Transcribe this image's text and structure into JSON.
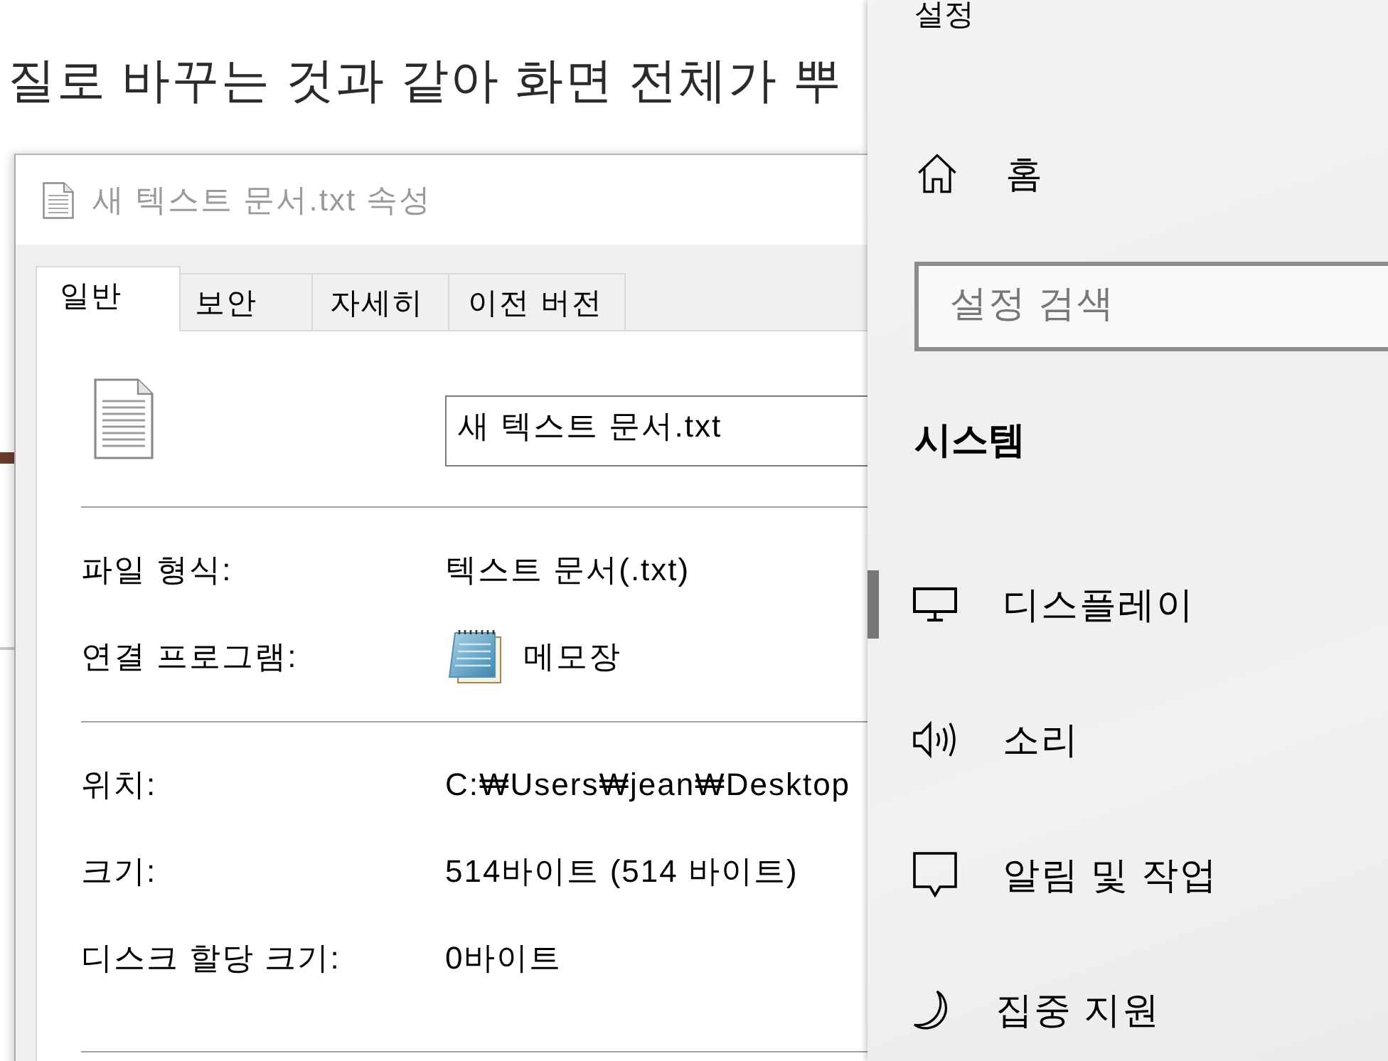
{
  "background_page": {
    "lines": [
      "질로 바꾸는 것과 같아 화면 전체가 뿌"
    ]
  },
  "properties_dialog": {
    "title": "새 텍스트 문서.txt 속성",
    "tabs": [
      {
        "label": "일반",
        "selected": true
      },
      {
        "label": "보안",
        "selected": false
      },
      {
        "label": "자세히",
        "selected": false
      },
      {
        "label": "이전 버전",
        "selected": false
      }
    ],
    "file_name": {
      "value": "새 텍스트 문서.txt"
    },
    "sections": [
      {
        "rows": [
          {
            "kind": "text",
            "label": "파일 형식:",
            "value": "텍스트 문서(.txt)"
          },
          {
            "kind": "app",
            "label": "연결 프로그램:",
            "value": "메모장"
          }
        ]
      },
      {
        "rows": [
          {
            "kind": "text",
            "label": "위치:",
            "value": "C:₩Users₩jean₩Desktop"
          },
          {
            "kind": "text",
            "label": "크기:",
            "value": "514바이트 (514 바이트)"
          },
          {
            "kind": "text",
            "label": "디스크 할당 크기:",
            "value": "0바이트"
          }
        ]
      }
    ]
  },
  "settings": {
    "title": "설정",
    "home": {
      "label": "홈"
    },
    "search": {
      "placeholder": "설정 검색"
    },
    "section_title": "시스템",
    "items": [
      {
        "label": "디스플레이",
        "selected": true
      },
      {
        "label": "소리",
        "selected": false
      },
      {
        "label": "알림 및 작업",
        "selected": false
      },
      {
        "label": "집중 지원",
        "selected": false
      }
    ]
  }
}
